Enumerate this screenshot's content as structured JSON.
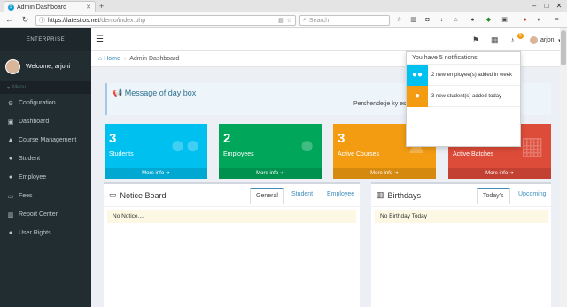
{
  "browser": {
    "tab_title": "Admin Dashboard",
    "url_host": "https://latestios.net",
    "url_path": "/demo/index.php",
    "search_placeholder": "Search"
  },
  "sidebar": {
    "logo_text": "ENTERPRISE",
    "welcome": "Welcome, arjoni",
    "menu_header": "Menu",
    "items": [
      {
        "label": "Configuration"
      },
      {
        "label": "Dashboard"
      },
      {
        "label": "Course Management"
      },
      {
        "label": "Student"
      },
      {
        "label": "Employee"
      },
      {
        "label": "Fees"
      },
      {
        "label": "Report Center"
      },
      {
        "label": "User Rights"
      }
    ]
  },
  "header": {
    "username": "arjoni",
    "notif_count": "5"
  },
  "breadcrumb": {
    "home": "Home",
    "current": "Admin Dashboard"
  },
  "daybox": {
    "title": "Message of day box",
    "text": "Pershendetje ky eshte"
  },
  "stats": [
    {
      "value": "3",
      "label": "Students",
      "footer": "More info",
      "color": "#00c0ef"
    },
    {
      "value": "2",
      "label": "Employees",
      "footer": "More info",
      "color": "#00a65a"
    },
    {
      "value": "3",
      "label": "Active Courses",
      "footer": "More info",
      "color": "#f39c12"
    },
    {
      "value": "",
      "label": "Active Batches",
      "footer": "More info",
      "color": "#dd4b39"
    }
  ],
  "notice_board": {
    "title": "Notice Board",
    "tabs": [
      "General",
      "Student",
      "Employee"
    ],
    "empty": "No Notice...."
  },
  "birthdays": {
    "title": "Birthdays",
    "tabs": [
      "Today's",
      "Upcoming"
    ],
    "empty": "No Birthday Today"
  },
  "notifications": {
    "header": "You have 5 notifications",
    "items": [
      {
        "text": "2 new employee(s) added in week",
        "color": "#00c0ef"
      },
      {
        "text": "3 new student(s) added today",
        "color": "#f39c12"
      }
    ]
  }
}
